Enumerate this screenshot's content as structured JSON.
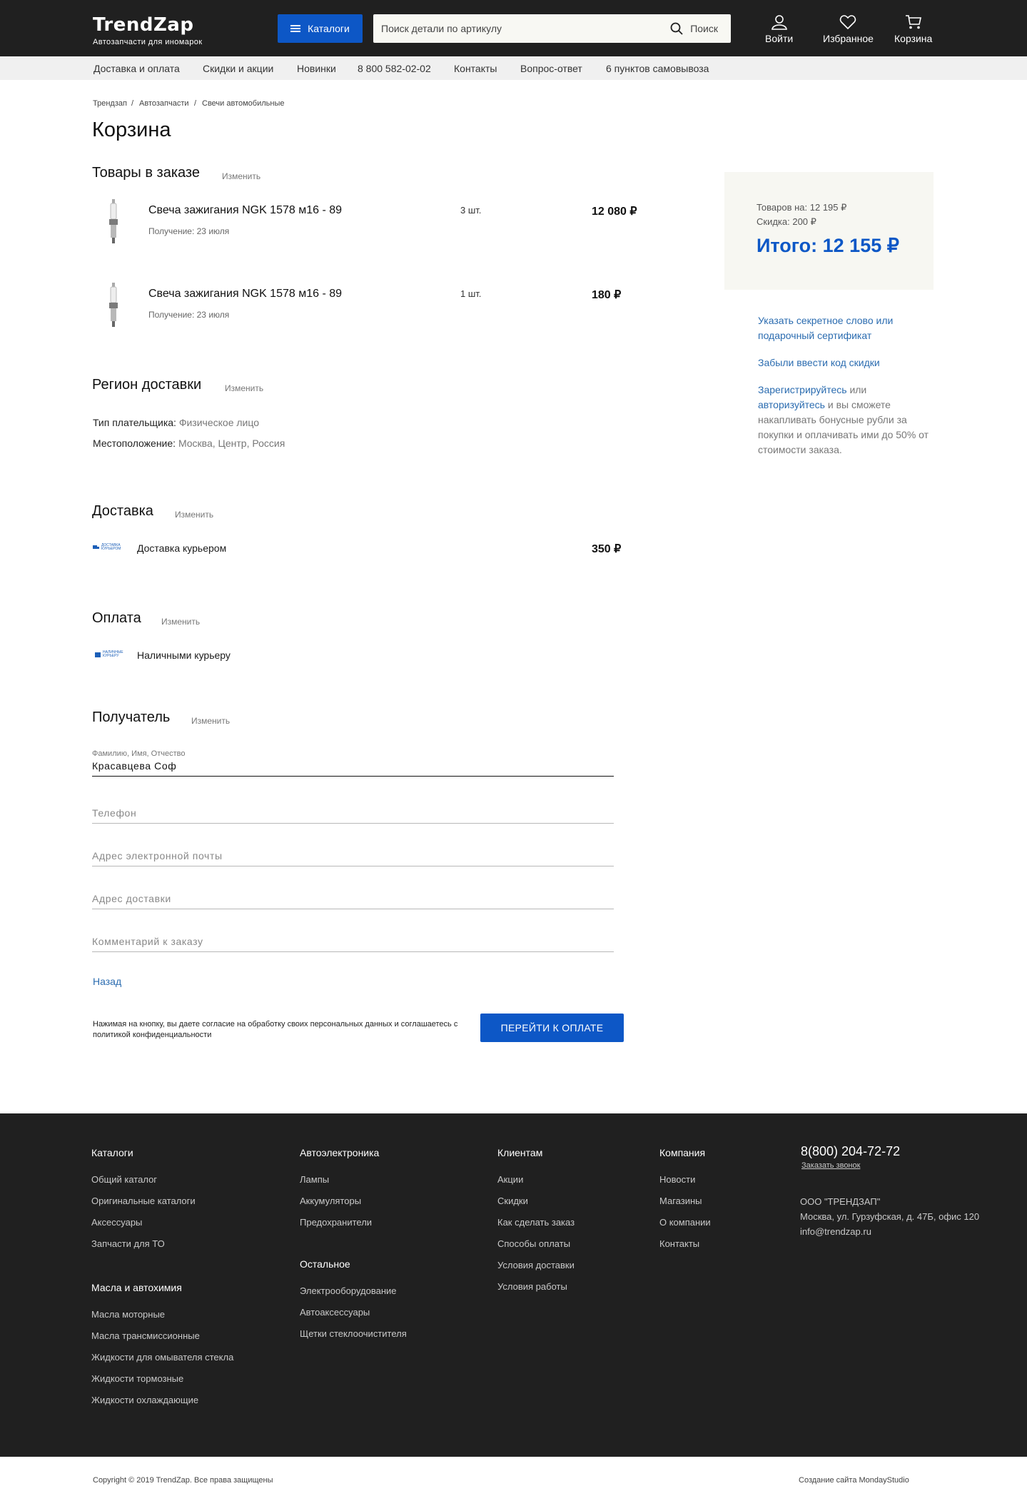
{
  "header": {
    "logo_title": "TrendZap",
    "logo_subtitle": "Автозапчасти для иномарок",
    "catalog_label": "Каталоги",
    "search_placeholder": "Поиск детали по артикулу",
    "search_button": "Поиск",
    "login_label": "Войти",
    "favorites_label": "Избранное",
    "cart_label": "Корзина"
  },
  "subnav": [
    "Доставка и оплата",
    "Скидки и акции",
    "Новинки",
    "8 800 582-02-02",
    "Контакты",
    "Вопрос-ответ",
    "6 пунктов самовывоза"
  ],
  "breadcrumbs": [
    "Трендзап",
    "Автозапчасти",
    "Свечи автомобильные"
  ],
  "breadcrumb_sep": "/",
  "page_title": "Корзина",
  "edit_label": "Изменить",
  "order": {
    "title": "Товары в заказе",
    "items": [
      {
        "name": "Свеча зажигания NGK 1578 м16 - 89",
        "delivery": "Получение: 23 июля",
        "qty": "3 шт.",
        "price": "12 080 ₽"
      },
      {
        "name": "Свеча зажигания NGK 1578 м16 - 89",
        "delivery": "Получение: 23 июля",
        "qty": "1 шт.",
        "price": "180 ₽"
      }
    ]
  },
  "region": {
    "title": "Регион доставки",
    "payer_label": "Тип плательщика:",
    "payer_value": "Физическое лицо",
    "location_label": "Местоположение:",
    "location_value": "Москва, Центр, Россия"
  },
  "delivery": {
    "title": "Доставка",
    "logo_text": "ДОСТАВКА КУРЬЕРОМ",
    "method": "Доставка курьером",
    "price": "350 ₽"
  },
  "payment": {
    "title": "Оплата",
    "logo_text": "НАЛИЧНЫЕ КУРЬЕРУ",
    "method": "Наличными курьеру"
  },
  "recipient": {
    "title": "Получатель",
    "name_label": "Фамилию, Имя, Отчество",
    "name_value": "Красавцева Соф",
    "phone_placeholder": "Телефон",
    "email_placeholder": "Адрес электронной почты",
    "address_placeholder": "Адрес доставки",
    "comment_placeholder": "Комментарий к заказу"
  },
  "back_label": "Назад",
  "consent_text": "Нажимая на кнопку, вы даете согласие на обработку своих персональных данных и соглашаетесь с политикой конфиденциальности",
  "pay_button": "ПЕРЕЙТИ К ОПЛАТЕ",
  "summary": {
    "goods": "Товаров на: 12 195 ₽",
    "discount": "Скидка: 200 ₽",
    "total": "Итого: 12 155 ₽"
  },
  "sidebar": {
    "secret_word": "Указать секретное слово или подарочный сертификат",
    "discount_code": "Забыли ввести код скидки",
    "register": "Зарегистрируйтесь",
    "or": "или",
    "authorize": "авторизуйтесь",
    "bonus_text": "и вы сможете накапливать бонусные рубли за покупки и оплачивать ими до 50% от стоимости заказа."
  },
  "footer": {
    "catalogs": {
      "title": "Каталоги",
      "links": [
        "Общий каталог",
        "Оригинальные каталоги",
        "Аксессуары",
        "Запчасти для ТО"
      ]
    },
    "oils": {
      "title": "Масла и автохимия",
      "links": [
        "Масла моторные",
        "Масла трансмиссионные",
        "Жидкости для омывателя стекла",
        "Жидкости тормозные",
        "Жидкости охлаждающие"
      ]
    },
    "electronics": {
      "title": "Автоэлектроника",
      "links": [
        "Лампы",
        "Аккумуляторы",
        "Предохранители"
      ]
    },
    "other": {
      "title": "Остальное",
      "links": [
        "Электрооборудование",
        "Автоаксессуары",
        "Щетки стеклоочистителя"
      ]
    },
    "clients": {
      "title": "Клиентам",
      "links": [
        "Акции",
        "Скидки",
        "Как сделать заказ",
        "Способы оплаты",
        "Условия доставки",
        "Условия работы"
      ]
    },
    "company": {
      "title": "Компания",
      "links": [
        "Новости",
        "Магазины",
        "О компании",
        "Контакты"
      ]
    },
    "phone": "8(800) 204-72-72",
    "call_request": "Заказать звонок",
    "company_name": "ООО \"ТРЕНДЗАП\"",
    "address": "Москва, ул. Гурзуфская, д. 47Б, офис 120",
    "email": "info@trendzap.ru",
    "copyright": "Copyright © 2019 TrendZap. Все права защищены",
    "made_by": "Создание сайта MondayStudio"
  },
  "colors": {
    "accent": "#0d57c6",
    "header_bg": "#202020",
    "link": "#2b6cb0",
    "summary_bg": "#f7f7f2"
  }
}
